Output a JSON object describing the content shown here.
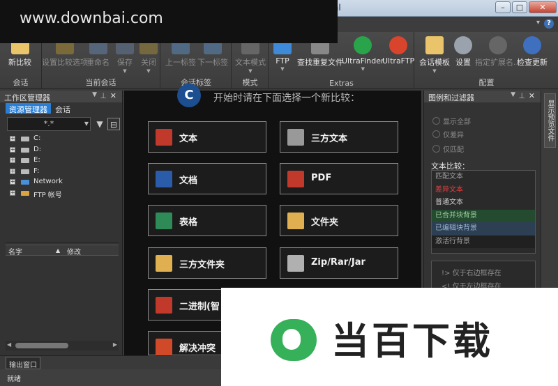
{
  "window": {
    "title_fragment": "al",
    "controls": [
      "–",
      "□",
      "✕"
    ]
  },
  "watermark": {
    "text": "www.downbai.com"
  },
  "ribbon": {
    "groups": [
      {
        "label": "会话",
        "buttons": [
          {
            "label": "新比较",
            "enabled": true,
            "icon": "folder-star-icon",
            "color": "#e9c46a"
          }
        ]
      },
      {
        "label": "当前会话",
        "buttons": [
          {
            "label": "设置比较选项",
            "enabled": false,
            "icon": "settings-icon",
            "color": "#7a6a3a"
          },
          {
            "label": "重命名",
            "enabled": false,
            "icon": "rename-icon",
            "color": "#55657a"
          },
          {
            "label": "保存",
            "enabled": false,
            "icon": "save-icon",
            "color": "#556070"
          },
          {
            "label": "关闭",
            "enabled": false,
            "icon": "close-folder-icon",
            "color": "#75683f"
          }
        ]
      },
      {
        "label": "会话标签",
        "buttons": [
          {
            "label": "上一标签",
            "enabled": false,
            "icon": "prev-tab-icon",
            "color": "#4f6a82"
          },
          {
            "label": "下一标签",
            "enabled": false,
            "icon": "next-tab-icon",
            "color": "#4f6a82"
          }
        ]
      },
      {
        "label": "模式",
        "buttons": [
          {
            "label": "文本模式",
            "enabled": false,
            "icon": "text-mode-icon",
            "color": "#666"
          }
        ]
      },
      {
        "label": "Extras",
        "buttons": [
          {
            "label": "FTP",
            "enabled": true,
            "icon": "ftp-cloud-icon",
            "color": "#3f8ad8"
          },
          {
            "label": "查找重复文件",
            "enabled": true,
            "icon": "duplicate-files-icon",
            "color": "#888"
          },
          {
            "label": "UltraFinder",
            "enabled": true,
            "icon": "ultrafinder-icon",
            "color": "#2aa44a"
          },
          {
            "label": "UltraFTP",
            "enabled": true,
            "icon": "ultraftp-icon",
            "color": "#d9442c"
          }
        ]
      },
      {
        "label": "配置",
        "buttons": [
          {
            "label": "会话模板",
            "enabled": true,
            "icon": "template-icon",
            "color": "#e9c46a"
          },
          {
            "label": "设置",
            "enabled": true,
            "icon": "gear-icon",
            "color": "#9aa3ad"
          },
          {
            "label": "指定扩展名...",
            "enabled": false,
            "icon": "gear-icon",
            "color": "#666"
          },
          {
            "label": "检查更新",
            "enabled": true,
            "icon": "update-globe-icon",
            "color": "#3f6fbf"
          }
        ]
      }
    ]
  },
  "left_panel": {
    "title": "工作区管理器",
    "tabs": [
      "资源管理器",
      "会话"
    ],
    "filter_value": "*.*",
    "tree": [
      "C:",
      "D:",
      "E:",
      "F:",
      "Network",
      "FTP 帐号"
    ],
    "columns": [
      "名字",
      "修改"
    ]
  },
  "center": {
    "hero": "开始时请在下面选择一个新比较：",
    "logo": "C",
    "buttons": [
      {
        "label": "文本",
        "icon": "text-file-icon",
        "color": "#c0392b"
      },
      {
        "label": "三方文本",
        "icon": "three-way-text-icon",
        "color": "#999"
      },
      {
        "label": "文档",
        "icon": "word-doc-icon",
        "color": "#2b5caa"
      },
      {
        "label": "PDF",
        "icon": "pdf-icon",
        "color": "#c0392b"
      },
      {
        "label": "表格",
        "icon": "spreadsheet-icon",
        "color": "#2e8b57"
      },
      {
        "label": "文件夹",
        "icon": "folder-icon",
        "color": "#e0b050"
      },
      {
        "label": "三方文件夹",
        "icon": "three-way-folder-icon",
        "color": "#e0b050"
      },
      {
        "label": "Zip/Rar/Jar",
        "icon": "archive-icon",
        "color": "#b0b0b0"
      },
      {
        "label": "二进制(智",
        "icon": "binary-icon",
        "color": "#c0392b"
      },
      {
        "label": "解决冲突",
        "icon": "git-merge-icon",
        "color": "#d04a2a"
      }
    ]
  },
  "right_panel": {
    "title": "图例和过滤器",
    "options": [
      "显示全部",
      "仅差异",
      "仅匹配"
    ],
    "compare_label": "文本比较：",
    "legend": [
      {
        "label": "匹配文本",
        "bg": "#2a2a2a",
        "fg": "#a0a0a0"
      },
      {
        "label": "差异文本",
        "bg": "#2a2a2a",
        "fg": "#e04040"
      },
      {
        "label": "普通文本",
        "bg": "#2a2a2a",
        "fg": "#cfcfcf"
      },
      {
        "label": "已合并块背景",
        "bg": "#244a30",
        "fg": "#9bd09b"
      },
      {
        "label": "已编辑块背景",
        "bg": "#2d3f52",
        "fg": "#9ab8d8"
      },
      {
        "label": "激活行背景",
        "bg": "#202020",
        "fg": "#a0a0a0"
      }
    ],
    "rules": [
      "!> 仅于右边框存在",
      "<! 仅于左边框存在"
    ]
  },
  "sidebar_strip": {
    "vertical_tab": "显示预览文件"
  },
  "bottom": {
    "tab": "输出窗口",
    "status": "就绪"
  },
  "overlay": {
    "brand": "当百下载"
  }
}
